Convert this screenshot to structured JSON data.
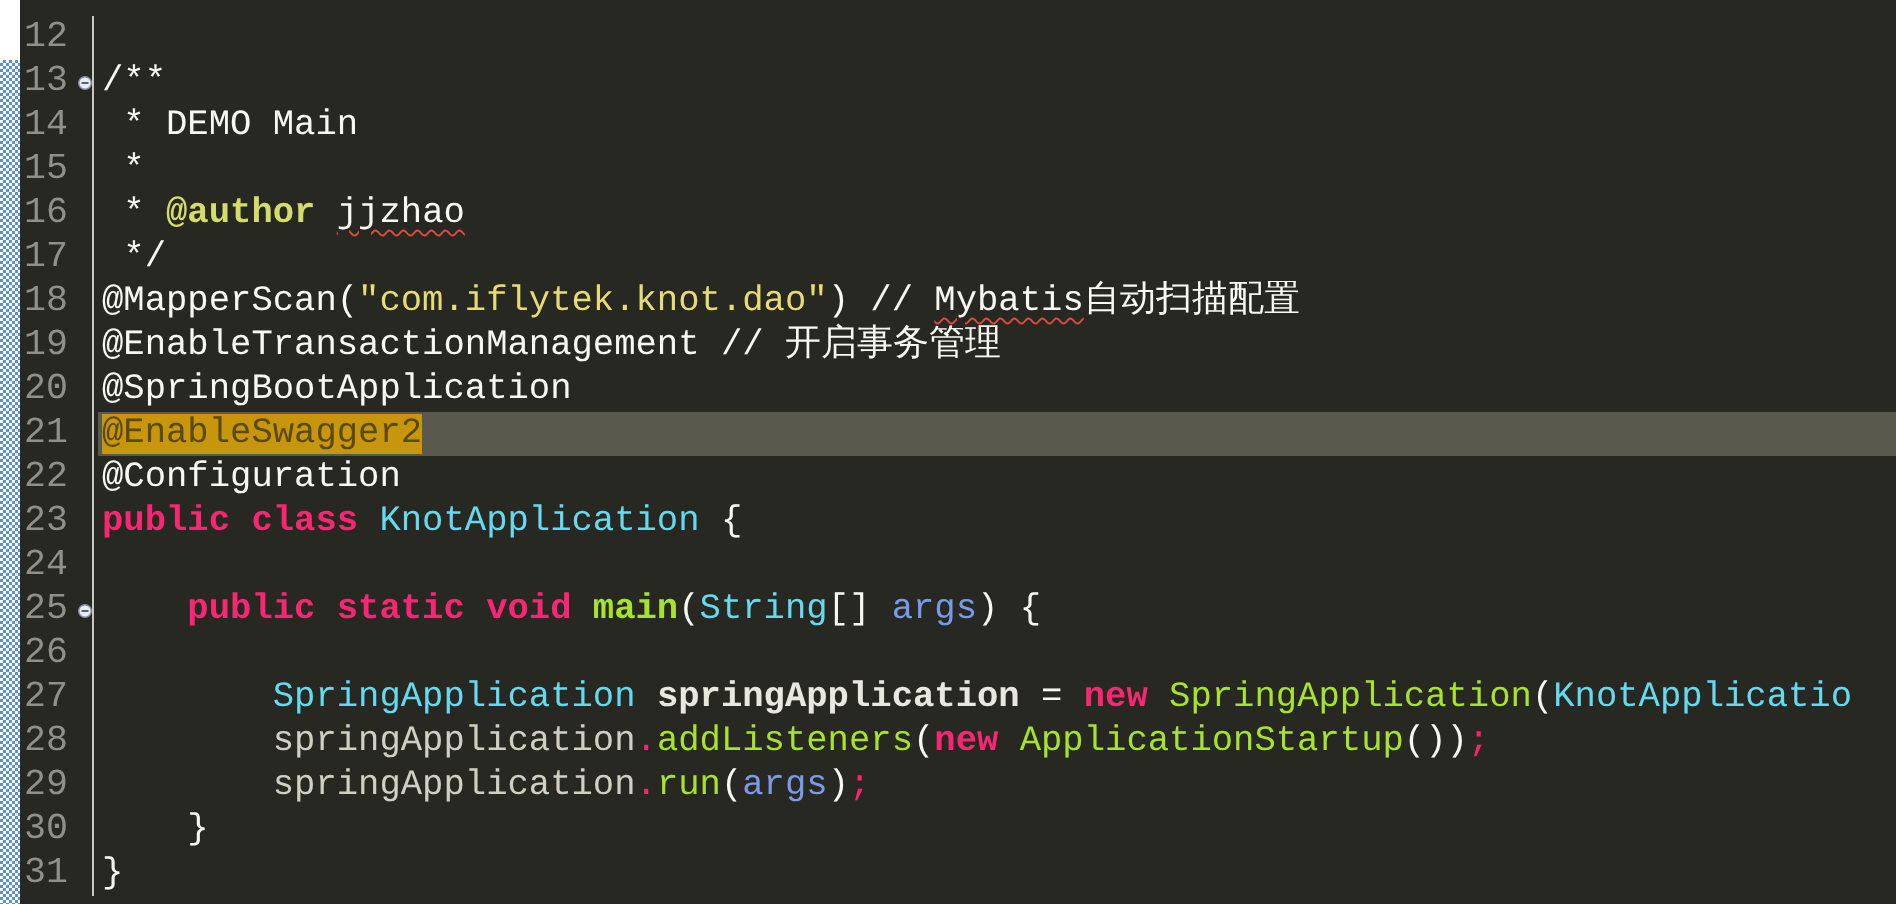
{
  "editor": {
    "lines": [
      {
        "number": "12",
        "fold": false,
        "highlighted": false
      },
      {
        "number": "13",
        "fold": true,
        "highlighted": false,
        "tokens": [
          {
            "kind": "plain",
            "text": "/**"
          }
        ]
      },
      {
        "number": "14",
        "fold": false,
        "highlighted": false,
        "tokens": [
          {
            "kind": "plain",
            "text": " * DEMO Main"
          }
        ]
      },
      {
        "number": "15",
        "fold": false,
        "highlighted": false,
        "tokens": [
          {
            "kind": "plain",
            "text": " *"
          }
        ]
      },
      {
        "number": "16",
        "fold": false,
        "highlighted": false,
        "tokens": [
          {
            "kind": "plain",
            "text": " * "
          },
          {
            "kind": "doctag",
            "text": "@author "
          },
          {
            "kind": "misspelled",
            "text": "jjzhao"
          }
        ]
      },
      {
        "number": "17",
        "fold": false,
        "highlighted": false,
        "tokens": [
          {
            "kind": "plain",
            "text": " */"
          }
        ]
      },
      {
        "number": "18",
        "fold": false,
        "highlighted": false,
        "tokens": [
          {
            "kind": "plain",
            "text": "@MapperScan("
          },
          {
            "kind": "string",
            "text": "\"com.iflytek.knot.dao\""
          },
          {
            "kind": "plain",
            "text": ") // "
          },
          {
            "kind": "misspelled",
            "text": "Mybatis"
          },
          {
            "kind": "plain",
            "text": "自动扫描配置"
          }
        ]
      },
      {
        "number": "19",
        "fold": false,
        "highlighted": false,
        "tokens": [
          {
            "kind": "plain",
            "text": "@EnableTransactionManagement // 开启事务管理"
          }
        ]
      },
      {
        "number": "20",
        "fold": false,
        "highlighted": false,
        "tokens": [
          {
            "kind": "plain",
            "text": "@SpringBootApplication"
          }
        ]
      },
      {
        "number": "21",
        "fold": false,
        "highlighted": true,
        "tokens": [
          {
            "kind": "match",
            "text": "@EnableSwagger2"
          }
        ]
      },
      {
        "number": "22",
        "fold": false,
        "highlighted": false,
        "tokens": [
          {
            "kind": "plain",
            "text": "@Configuration"
          }
        ]
      },
      {
        "number": "23",
        "fold": false,
        "highlighted": false,
        "tokens": [
          {
            "kind": "keyword",
            "text": "public class "
          },
          {
            "kind": "type",
            "text": "KnotApplication"
          },
          {
            "kind": "plain",
            "text": " {"
          }
        ]
      },
      {
        "number": "24",
        "fold": false,
        "highlighted": false
      },
      {
        "number": "25",
        "fold": true,
        "highlighted": false,
        "tokens": [
          {
            "kind": "keyword",
            "text": "    public static void "
          },
          {
            "kind": "method_def",
            "text": "main"
          },
          {
            "kind": "plain",
            "text": "("
          },
          {
            "kind": "type",
            "text": "String"
          },
          {
            "kind": "plain",
            "text": "[] "
          },
          {
            "kind": "param",
            "text": "args"
          },
          {
            "kind": "plain",
            "text": ") {"
          }
        ]
      },
      {
        "number": "26",
        "fold": false,
        "highlighted": false
      },
      {
        "number": "27",
        "fold": false,
        "highlighted": false,
        "tokens": [
          {
            "kind": "type",
            "text": "        SpringApplication "
          },
          {
            "kind": "variable_def",
            "text": "springApplication"
          },
          {
            "kind": "plain",
            "text": " = "
          },
          {
            "kind": "keyword",
            "text": "new "
          },
          {
            "kind": "method",
            "text": "SpringApplication"
          },
          {
            "kind": "plain",
            "text": "("
          },
          {
            "kind": "type",
            "text": "KnotApplicatio"
          }
        ]
      },
      {
        "number": "28",
        "fold": false,
        "highlighted": false,
        "tokens": [
          {
            "kind": "variable",
            "text": "        springApplication"
          },
          {
            "kind": "op",
            "text": "."
          },
          {
            "kind": "method",
            "text": "addListeners"
          },
          {
            "kind": "plain",
            "text": "("
          },
          {
            "kind": "keyword",
            "text": "new "
          },
          {
            "kind": "method",
            "text": "ApplicationStartup"
          },
          {
            "kind": "plain",
            "text": "())"
          },
          {
            "kind": "op",
            "text": ";"
          }
        ]
      },
      {
        "number": "29",
        "fold": false,
        "highlighted": false,
        "tokens": [
          {
            "kind": "variable",
            "text": "        springApplication"
          },
          {
            "kind": "op",
            "text": "."
          },
          {
            "kind": "method",
            "text": "run"
          },
          {
            "kind": "plain",
            "text": "("
          },
          {
            "kind": "param",
            "text": "args"
          },
          {
            "kind": "plain",
            "text": ")"
          },
          {
            "kind": "op",
            "text": ";"
          }
        ]
      },
      {
        "number": "30",
        "fold": false,
        "highlighted": false,
        "tokens": [
          {
            "kind": "plain",
            "text": "    }"
          }
        ]
      },
      {
        "number": "31",
        "fold": false,
        "highlighted": false,
        "tokens": [
          {
            "kind": "plain",
            "text": "}"
          }
        ]
      }
    ]
  }
}
